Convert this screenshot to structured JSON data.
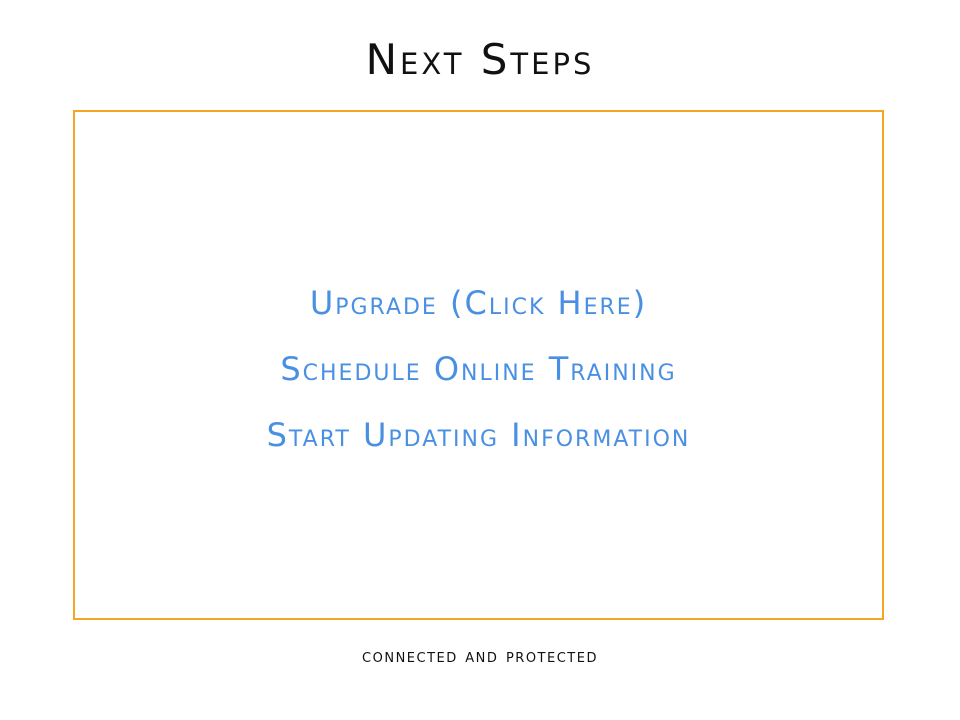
{
  "slide": {
    "title": "Next Steps",
    "footer": "connected and protected"
  },
  "panel": {
    "links": [
      {
        "label": "Upgrade (Click Here)"
      },
      {
        "label": "Schedule Online Training"
      },
      {
        "label": "Start Updating Information"
      }
    ]
  },
  "colors": {
    "border": "#f5a623",
    "link": "#4a90e2",
    "text": "#111111"
  }
}
